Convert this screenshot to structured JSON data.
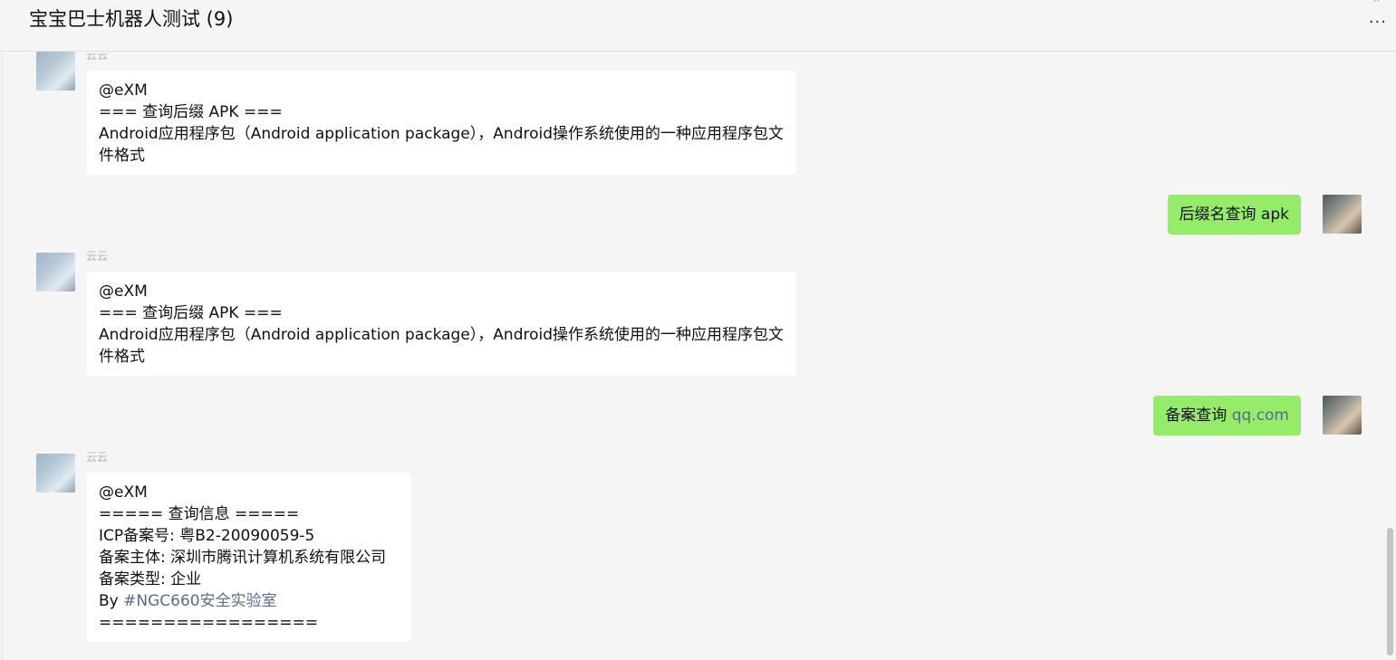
{
  "window": {
    "title": "宝宝巴士机器人测试 (9)",
    "more_label": "···"
  },
  "messages": [
    {
      "side": "left",
      "sender": "云云",
      "lines": [
        "@eXM",
        "=== 查询后缀 APK ===",
        " Android应用程序包（Android application package），Android操作系统使用的一种应用程序包文件格式"
      ]
    },
    {
      "side": "right",
      "text": "后缀名查询 apk"
    },
    {
      "side": "left",
      "sender": "云云",
      "lines": [
        "@eXM",
        "=== 查询后缀 APK ===",
        " Android应用程序包（Android application package），Android操作系统使用的一种应用程序包文件格式"
      ]
    },
    {
      "side": "right",
      "text_prefix": "备案查询 ",
      "text_link": "qq.com"
    },
    {
      "side": "left",
      "sender": "云云",
      "lines": [
        "@eXM",
        "===== 查询信息 =====",
        "ICP备案号: 粤B2-20090059-5",
        "备案主体: 深圳市腾讯计算机系统有限公司",
        "备案类型: 企业"
      ],
      "by_prefix": "By ",
      "by_link": "#NGC660安全实验室",
      "footer": "================="
    }
  ]
}
